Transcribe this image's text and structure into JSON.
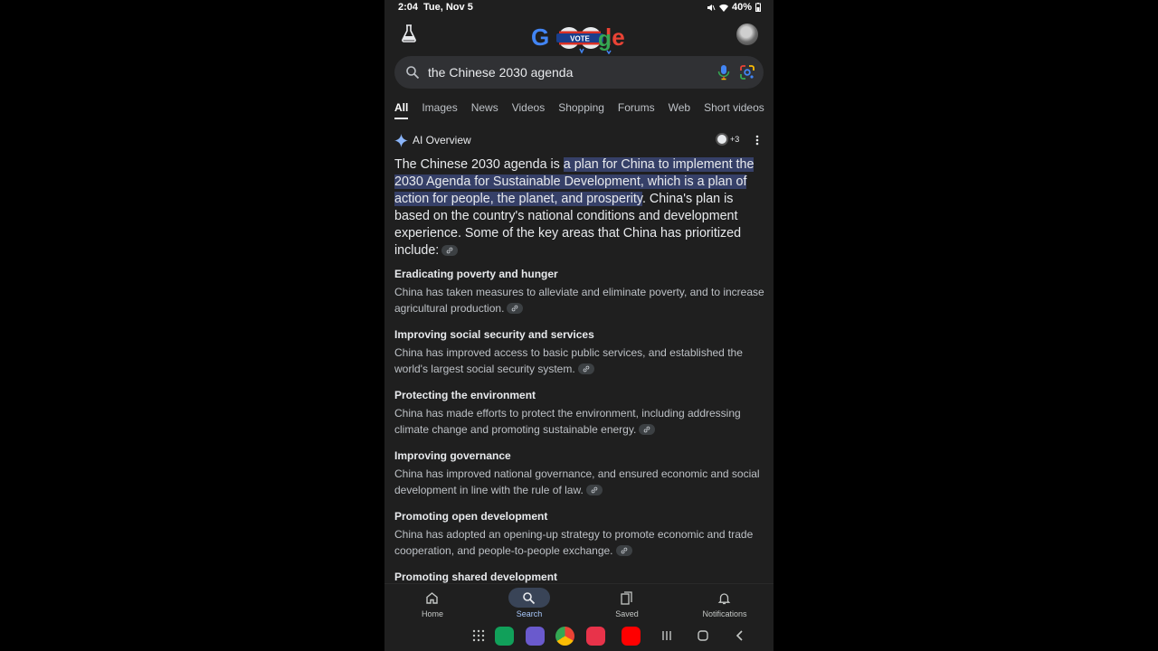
{
  "status_bar": {
    "time": "2:04",
    "date": "Tue, Nov 5",
    "battery": "40%"
  },
  "header": {
    "logo_alt": "Google",
    "doodle_badge": "VOTE"
  },
  "search": {
    "query": "the Chinese 2030 agenda"
  },
  "tabs": [
    "All",
    "Images",
    "News",
    "Videos",
    "Shopping",
    "Forums",
    "Web",
    "Short videos"
  ],
  "ai_overview": {
    "title": "AI Overview",
    "sources_extra": "+3",
    "intro_before": "The Chinese 2030 agenda is ",
    "intro_highlight": "a plan for China to implement the 2030 Agenda for Sustainable Development, which is a plan of action for people, the planet, and prosperity",
    "intro_after": ". China's plan is based on the country's national conditions and development experience. Some of the key areas that China has prioritized include:",
    "items": [
      {
        "heading": "Eradicating poverty and hunger",
        "text": "China has taken measures to alleviate and eliminate poverty, and to increase agricultural production."
      },
      {
        "heading": "Improving social security and services",
        "text": "China has improved access to basic public services, and established the world's largest social security system."
      },
      {
        "heading": "Protecting the environment",
        "text": "China has made efforts to protect the environment, including addressing climate change and promoting sustainable energy."
      },
      {
        "heading": "Improving governance",
        "text": "China has improved national governance, and ensured economic and social development in line with the rule of law."
      },
      {
        "heading": "Promoting open development",
        "text": "China has adopted an opening-up strategy to promote economic and trade cooperation, and people-to-people exchange."
      },
      {
        "heading": "Promoting shared development",
        "text": ""
      }
    ]
  },
  "bottom_nav": [
    {
      "label": "Home",
      "icon": "home-icon"
    },
    {
      "label": "Search",
      "icon": "search-icon"
    },
    {
      "label": "Saved",
      "icon": "saved-icon"
    },
    {
      "label": "Notifications",
      "icon": "bell-icon"
    }
  ],
  "colors": {
    "background": "#1f1f1f",
    "highlight": "#364068",
    "accent": "#a8c7fa"
  }
}
